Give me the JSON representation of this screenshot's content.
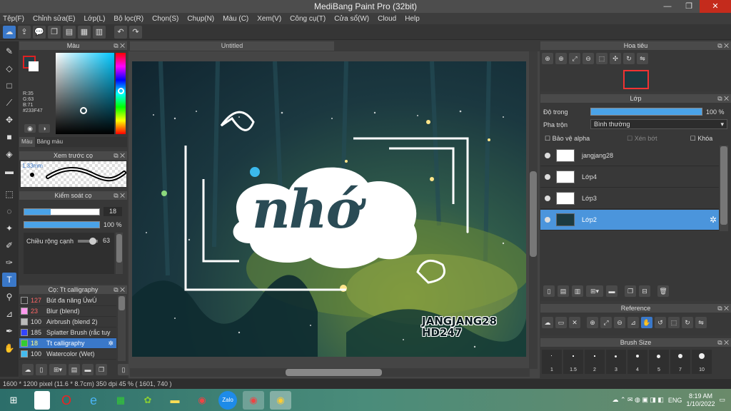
{
  "window": {
    "title": "MediBang Paint Pro (32bit)",
    "min": "—",
    "max": "❐",
    "close": "✕"
  },
  "menu": [
    "Tệp(F)",
    "Chỉnh sửa(E)",
    "Lớp(L)",
    "Bộ lọc(R)",
    "Chọn(S)",
    "Chụp(N)",
    "Màu (C)",
    "Xem(V)",
    "Công cụ(T)",
    "Cửa sổ(W)",
    "Cloud",
    "Help"
  ],
  "toolbar_icons": [
    "cloud-icon",
    "share-icon",
    "comment-icon",
    "copy-icon",
    "doc-icon",
    "grid-icon",
    "panel-icon",
    "undo-icon",
    "redo-icon"
  ],
  "color_panel": {
    "title": "Màu",
    "fg_color": "#233F47",
    "r": "R:35",
    "g": "G:63",
    "b": "B:71",
    "hex": "#233F47",
    "tab_color": "Màu",
    "tab_palette": "Bảng màu"
  },
  "brush_preview": {
    "title": "Xem trước cọ",
    "size": "1.33mm"
  },
  "brush_control": {
    "title": "Kiểm soát cọ",
    "size_value": "18",
    "size_fill": 0.35,
    "opacity_value": "100 %",
    "opacity_fill": 1.0,
    "edge_label": "Chiều rộng cạnh",
    "edge_value": "63"
  },
  "brush_list": {
    "title": "Cọ: Tt calligraphy",
    "items": [
      {
        "num": "127",
        "name": "Bút đa năng ÚwÚ",
        "color": "#333333"
      },
      {
        "num": "23",
        "name": "Blur (blend)",
        "color": "#ff99ee"
      },
      {
        "num": "100",
        "name": "Airbrush (blend 2)",
        "color": "#bbbbbb"
      },
      {
        "num": "185",
        "name": "Splatter Brush (rắc tuy",
        "color": "#3344ff"
      },
      {
        "num": "18",
        "name": "Tt calligraphy",
        "color": "#33cc33"
      },
      {
        "num": "100",
        "name": "Watercolor (Wet)",
        "color": "#44bbee"
      }
    ]
  },
  "canvas": {
    "tab": "Untitled",
    "artwork_text": "nhớ",
    "signature_line1": "JANGJANG28",
    "signature_line2": "HD247"
  },
  "status": "1600 * 1200 pixel   (11.6 * 8.7cm)   350 dpi   45 %   ( 1601, 740 )",
  "navigator": {
    "title": "Hoa tiêu"
  },
  "layers": {
    "title": "Lớp",
    "opacity_label": "Độ trong",
    "opacity_value": "100 %",
    "opacity_fill": 1.0,
    "blend_label": "Pha trộn",
    "blend_value": "Bình thường",
    "protect_alpha": "Bảo vệ alpha",
    "clipping": "Xén bớt",
    "lock": "Khóa",
    "items": [
      {
        "name": "jangjang28",
        "selected": false
      },
      {
        "name": "Lớp4",
        "selected": false
      },
      {
        "name": "Lớp3",
        "selected": false
      },
      {
        "name": "Lớp2",
        "selected": true
      }
    ]
  },
  "reference": {
    "title": "Reference"
  },
  "brush_size": {
    "title": "Brush Size",
    "sizes": [
      "1",
      "1.5",
      "2",
      "3",
      "4",
      "5",
      "7",
      "10"
    ]
  },
  "taskbar": {
    "lang": "ENG",
    "time": "8:19 AM",
    "date": "1/10/2022"
  }
}
